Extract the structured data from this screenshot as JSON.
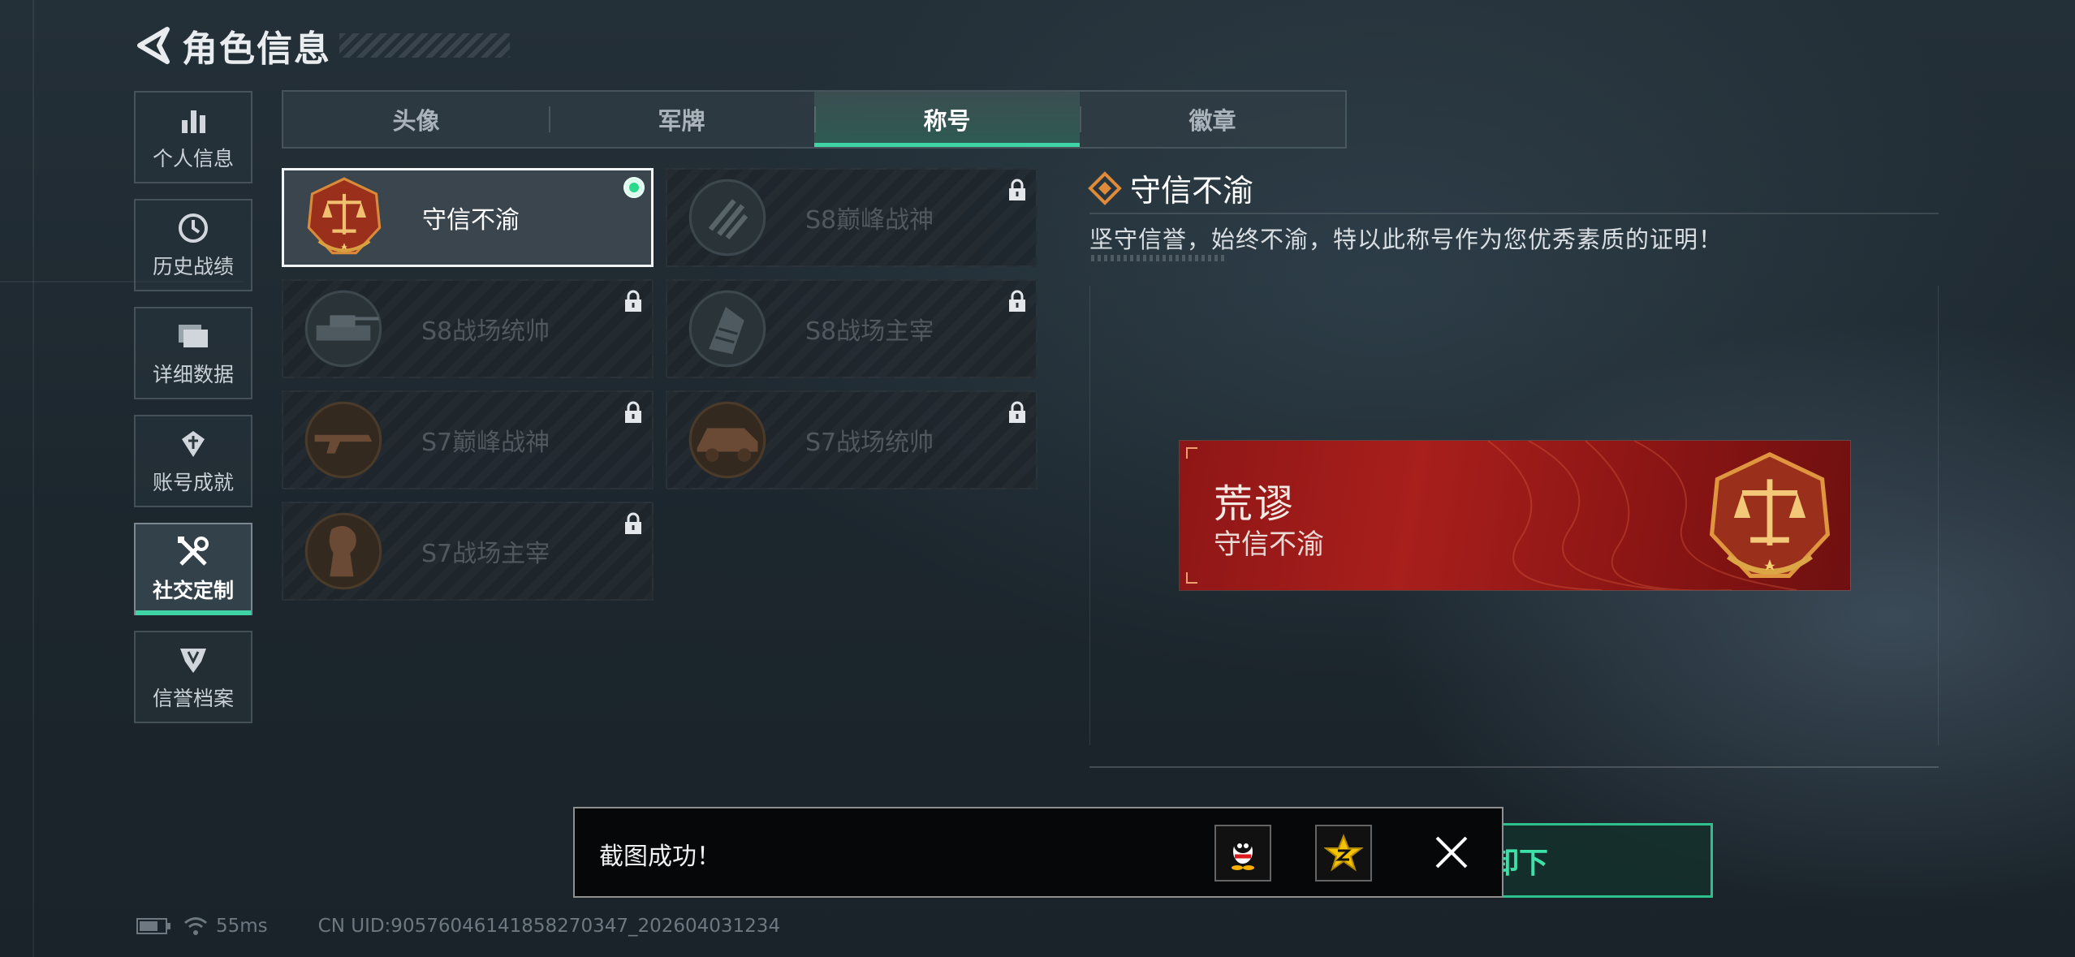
{
  "header": {
    "title": "角色信息"
  },
  "sidenav": {
    "items": [
      {
        "label": "个人信息",
        "icon": "bar-chart-icon",
        "active": false
      },
      {
        "label": "历史战绩",
        "icon": "clock-icon",
        "active": false
      },
      {
        "label": "详细数据",
        "icon": "folder-icon",
        "active": false
      },
      {
        "label": "账号成就",
        "icon": "achievement-icon",
        "active": false
      },
      {
        "label": "社交定制",
        "icon": "tools-icon",
        "active": true
      },
      {
        "label": "信誉档案",
        "icon": "credit-shield-icon",
        "active": false
      }
    ]
  },
  "tabs": [
    {
      "label": "头像",
      "active": false
    },
    {
      "label": "军牌",
      "active": false
    },
    {
      "label": "称号",
      "active": true
    },
    {
      "label": "徽章",
      "active": false
    }
  ],
  "titles": [
    {
      "label": "守信不渝",
      "locked": false,
      "selected": true,
      "equipped": true,
      "icon": "scales-emblem-icon"
    },
    {
      "label": "S8巅峰战神",
      "locked": true,
      "selected": false,
      "icon": "s8-peak-emblem-icon"
    },
    {
      "label": "S8战场统帅",
      "locked": true,
      "selected": false,
      "icon": "s8-tank-emblem-icon"
    },
    {
      "label": "S8战场主宰",
      "locked": true,
      "selected": false,
      "icon": "s8-building-emblem-icon"
    },
    {
      "label": "S7巅峰战神",
      "locked": true,
      "selected": false,
      "icon": "s7-gun-emblem-icon"
    },
    {
      "label": "S7战场统帅",
      "locked": true,
      "selected": false,
      "icon": "s7-vehicle-emblem-icon"
    },
    {
      "label": "S7战场主宰",
      "locked": true,
      "selected": false,
      "icon": "s7-soldier-emblem-icon"
    }
  ],
  "detail": {
    "name": "守信不渝",
    "description": "坚守信誉，始终不渝，特以此称号作为您优秀素质的证明！"
  },
  "banner": {
    "player_name": "荒谬",
    "title": "守信不渝"
  },
  "toast": {
    "message": "截图成功！",
    "share_targets": [
      "qq-icon",
      "qzone-icon"
    ]
  },
  "confirm_button": {
    "label": "卸下"
  },
  "footer": {
    "latency": "55ms",
    "uid": "CN UID:9057604614185827034​7_202604031234"
  },
  "colors": {
    "accent": "#3fd4a6",
    "banner_red": "#a81f1c",
    "equipped_dot": "#2bd98b"
  }
}
